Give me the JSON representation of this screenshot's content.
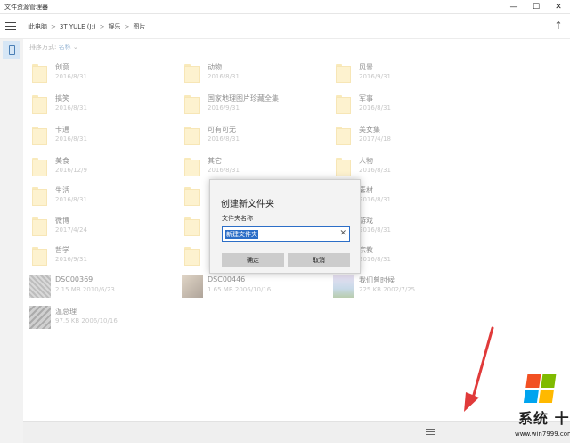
{
  "window": {
    "title": "文件资源管理器",
    "min_glyph": "—",
    "max_glyph": "☐",
    "close_glyph": "✕"
  },
  "breadcrumb": [
    "此电脑",
    "3T YULE (J:)",
    "娱乐",
    "图片"
  ],
  "breadcrumb_sep": ">",
  "sort": {
    "label": "排序方式:",
    "value": "名称",
    "chevron": "⌄"
  },
  "folders": [
    {
      "name": "创意",
      "date": "2016/8/31"
    },
    {
      "name": "动物",
      "date": "2016/8/31"
    },
    {
      "name": "风景",
      "date": "2016/9/31"
    },
    {
      "name": "搞笑",
      "date": "2016/8/31"
    },
    {
      "name": "国家地理图片珍藏全集",
      "date": "2016/9/31"
    },
    {
      "name": "军事",
      "date": "2016/8/31"
    },
    {
      "name": "卡通",
      "date": "2016/8/31"
    },
    {
      "name": "可有可无",
      "date": "2016/8/31"
    },
    {
      "name": "美女集",
      "date": "2017/4/18"
    },
    {
      "name": "美食",
      "date": "2016/12/9"
    },
    {
      "name": "其它",
      "date": "2016/8/31"
    },
    {
      "name": "人物",
      "date": "2016/8/31"
    },
    {
      "name": "生活",
      "date": "2016/8/31"
    },
    {
      "name": "",
      "date": ""
    },
    {
      "name": "素材",
      "date": "2016/8/31"
    },
    {
      "name": "微博",
      "date": "2017/4/24"
    },
    {
      "name": "",
      "date": ""
    },
    {
      "name": "游戏",
      "date": "2016/8/31"
    },
    {
      "name": "哲学",
      "date": "2016/9/31"
    },
    {
      "name": "",
      "date": ""
    },
    {
      "name": "宗教",
      "date": "2016/8/31"
    }
  ],
  "files": [
    {
      "name": "DSC00369",
      "meta": "2.15 MB 2010/6/23"
    },
    {
      "name": "DSC00446",
      "meta": "1.65 MB 2006/10/16"
    },
    {
      "name": "我们曾时候",
      "meta": "225 KB 2002/7/25"
    },
    {
      "name": "温总理",
      "meta": "97.5 KB 2006/10/16"
    }
  ],
  "dialog": {
    "title": "创建新文件夹",
    "field_label": "文件夹名称",
    "input_value": "新建文件夹",
    "clear_glyph": "✕",
    "ok_label": "确定",
    "cancel_label": "取消"
  },
  "watermark": {
    "text": "系统 十分",
    "url": "www.win7999.com",
    "colors": [
      "#f25022",
      "#7fba00",
      "#00a4ef",
      "#ffb900"
    ]
  },
  "arrow_color": "#e03a3a"
}
